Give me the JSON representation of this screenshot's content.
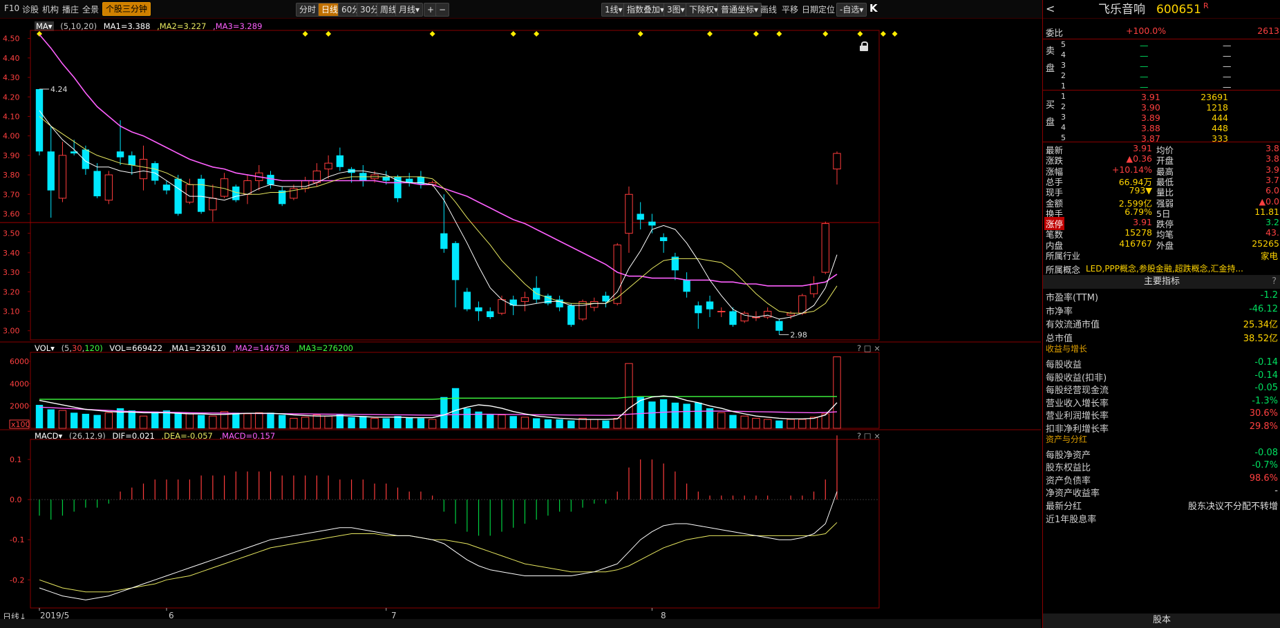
{
  "toolbar": {
    "left_items": [
      "F10",
      "诊股",
      "机构",
      "播庄",
      "全景"
    ],
    "active_item": "个股三分钟",
    "period_tabs": [
      "分时",
      "日线",
      "60分",
      "30分",
      "周线",
      "月线▾"
    ],
    "active_period": "日线",
    "zoom_in": "+",
    "zoom_out": "−",
    "right_items": [
      "1线▾",
      "指数叠加▾",
      "3图▾",
      "下除权▾",
      "普通坐标▾",
      "画线",
      "平移",
      "日期定位",
      "-自选▾"
    ],
    "expand": "K"
  },
  "ma_legend": {
    "label": "MA▾",
    "params": "(5,10,20)",
    "ma1": "MA1=3.388",
    "ma2": ",MA2=3.227",
    "ma3": ",MA3=3.289"
  },
  "vol_legend": {
    "label": "VOL▾",
    "params_a": "(5,",
    "params_b": "30",
    "params_c": ",",
    "params_d": "120)",
    "vol": "VOL=669422",
    "ma1": ",MA1=232610",
    "ma2": ",MA2=146758",
    "ma3": ",MA3=276200"
  },
  "macd_legend": {
    "label": "MACD▾",
    "params": "(26,12,9)",
    "dif": "DIF=0.021",
    "dea": ",DEA=-0.057",
    "macd": ",MACD=0.157"
  },
  "price_axis": [
    "4.50",
    "4.40",
    "4.30",
    "4.20",
    "4.10",
    "4.00",
    "3.90",
    "3.80",
    "3.70",
    "3.60",
    "3.50",
    "3.40",
    "3.30",
    "3.20",
    "3.10",
    "3.00"
  ],
  "vol_axis": [
    "6000",
    "4000",
    "2000"
  ],
  "vol_unit": "x100",
  "macd_axis": [
    "0.1",
    "0.0",
    "-0.1",
    "-0.2"
  ],
  "annotations": {
    "high": "4.24",
    "low": "2.98"
  },
  "x_labels": [
    "2019/5",
    "6",
    "7",
    "8"
  ],
  "bottom_left": "日线↓",
  "panel_controls": "? □ ×",
  "chart_data": {
    "type": "candlestick",
    "ylim": [
      2.96,
      4.52
    ],
    "candles": [
      [
        4.24,
        3.92,
        4.24,
        3.9
      ],
      [
        3.92,
        3.72,
        4.05,
        3.58
      ],
      [
        3.68,
        3.9,
        3.97,
        3.66
      ],
      [
        3.92,
        3.91,
        3.98,
        3.9
      ],
      [
        3.93,
        3.83,
        3.95,
        3.8
      ],
      [
        3.82,
        3.69,
        3.86,
        3.68
      ],
      [
        3.67,
        3.8,
        3.82,
        3.65
      ],
      [
        3.92,
        3.89,
        4.08,
        3.85
      ],
      [
        3.9,
        3.85,
        3.92,
        3.8
      ],
      [
        3.78,
        3.88,
        3.95,
        3.72
      ],
      [
        3.86,
        3.77,
        3.87,
        3.75
      ],
      [
        3.75,
        3.72,
        3.77,
        3.7
      ],
      [
        3.78,
        3.6,
        3.8,
        3.59
      ],
      [
        3.66,
        3.75,
        3.78,
        3.65
      ],
      [
        3.78,
        3.61,
        3.8,
        3.6
      ],
      [
        3.62,
        3.68,
        3.75,
        3.56
      ],
      [
        3.69,
        3.78,
        3.81,
        3.68
      ],
      [
        3.74,
        3.67,
        3.75,
        3.66
      ],
      [
        3.7,
        3.77,
        3.8,
        3.65
      ],
      [
        3.77,
        3.81,
        3.85,
        3.72
      ],
      [
        3.8,
        3.75,
        3.82,
        3.73
      ],
      [
        3.72,
        3.65,
        3.74,
        3.64
      ],
      [
        3.68,
        3.73,
        3.75,
        3.67
      ],
      [
        3.73,
        3.77,
        3.79,
        3.71
      ],
      [
        3.76,
        3.82,
        3.86,
        3.74
      ],
      [
        3.83,
        3.86,
        3.9,
        3.78
      ],
      [
        3.9,
        3.84,
        3.94,
        3.82
      ],
      [
        3.83,
        3.81,
        3.84,
        3.76
      ],
      [
        3.81,
        3.77,
        3.85,
        3.74
      ],
      [
        3.78,
        3.8,
        3.82,
        3.76
      ],
      [
        3.79,
        3.77,
        3.82,
        3.75
      ],
      [
        3.79,
        3.68,
        3.8,
        3.66
      ],
      [
        3.78,
        3.76,
        3.81,
        3.74
      ],
      [
        3.79,
        3.75,
        3.82,
        3.73
      ],
      [
        3.75,
        3.76,
        3.77,
        3.74
      ],
      [
        3.5,
        3.42,
        3.7,
        3.4
      ],
      [
        3.45,
        3.26,
        3.46,
        3.12
      ],
      [
        3.2,
        3.11,
        3.22,
        3.1
      ],
      [
        3.12,
        3.1,
        3.15,
        3.05
      ],
      [
        3.1,
        3.07,
        3.12,
        3.06
      ],
      [
        3.09,
        3.16,
        3.18,
        3.08
      ],
      [
        3.16,
        3.13,
        3.18,
        3.08
      ],
      [
        3.15,
        3.17,
        3.2,
        3.1
      ],
      [
        3.22,
        3.16,
        3.28,
        3.14
      ],
      [
        3.18,
        3.14,
        3.19,
        3.13
      ],
      [
        3.16,
        3.12,
        3.18,
        3.1
      ],
      [
        3.13,
        3.03,
        3.14,
        3.02
      ],
      [
        3.06,
        3.15,
        3.16,
        3.05
      ],
      [
        3.12,
        3.15,
        3.17,
        3.1
      ],
      [
        3.18,
        3.15,
        3.2,
        3.12
      ],
      [
        3.14,
        3.44,
        3.45,
        3.13
      ],
      [
        3.5,
        3.7,
        3.74,
        3.4
      ],
      [
        3.6,
        3.57,
        3.66,
        3.52
      ],
      [
        3.56,
        3.54,
        3.6,
        3.5
      ],
      [
        3.48,
        3.46,
        3.5,
        3.4
      ],
      [
        3.38,
        3.31,
        3.4,
        3.26
      ],
      [
        3.26,
        3.2,
        3.3,
        3.17
      ],
      [
        3.13,
        3.09,
        3.15,
        3.01
      ],
      [
        3.15,
        3.11,
        3.18,
        3.07
      ],
      [
        3.1,
        3.1,
        3.12,
        3.07
      ],
      [
        3.1,
        3.03,
        3.12,
        3.02
      ],
      [
        3.05,
        3.09,
        3.1,
        3.04
      ],
      [
        3.07,
        3.07,
        3.1,
        3.05
      ],
      [
        3.07,
        3.1,
        3.12,
        3.06
      ],
      [
        3.05,
        3.0,
        3.06,
        2.98
      ],
      [
        3.08,
        3.09,
        3.1,
        3.06
      ],
      [
        3.09,
        3.18,
        3.19,
        3.08
      ],
      [
        3.19,
        3.24,
        3.28,
        3.17
      ],
      [
        3.3,
        3.55,
        3.56,
        3.29
      ],
      [
        3.83,
        3.91,
        3.92,
        3.75
      ]
    ],
    "ma5": [
      4.13,
      4.05,
      3.98,
      3.93,
      3.87,
      3.84,
      3.84,
      3.82,
      3.81,
      3.82,
      3.81,
      3.77,
      3.73,
      3.69,
      3.69,
      3.68,
      3.67,
      3.69,
      3.7,
      3.73,
      3.75,
      3.74,
      3.74,
      3.74,
      3.76,
      3.79,
      3.81,
      3.82,
      3.82,
      3.81,
      3.8,
      3.77,
      3.76,
      3.76,
      3.75,
      3.67,
      3.56,
      3.45,
      3.33,
      3.22,
      3.16,
      3.13,
      3.13,
      3.14,
      3.15,
      3.15,
      3.13,
      3.13,
      3.14,
      3.14,
      3.2,
      3.32,
      3.41,
      3.52,
      3.54,
      3.52,
      3.45,
      3.36,
      3.26,
      3.18,
      3.11,
      3.08,
      3.07,
      3.08,
      3.06,
      3.07,
      3.09,
      3.13,
      3.22,
      3.39
    ],
    "ma10": [
      4.1,
      4.05,
      4.01,
      3.97,
      3.93,
      3.9,
      3.88,
      3.86,
      3.85,
      3.84,
      3.83,
      3.81,
      3.78,
      3.75,
      3.75,
      3.74,
      3.73,
      3.71,
      3.7,
      3.7,
      3.71,
      3.71,
      3.72,
      3.73,
      3.74,
      3.76,
      3.78,
      3.79,
      3.79,
      3.79,
      3.79,
      3.79,
      3.79,
      3.79,
      3.78,
      3.73,
      3.66,
      3.58,
      3.51,
      3.44,
      3.36,
      3.3,
      3.24,
      3.19,
      3.17,
      3.15,
      3.14,
      3.14,
      3.14,
      3.14,
      3.17,
      3.22,
      3.27,
      3.32,
      3.36,
      3.37,
      3.37,
      3.37,
      3.36,
      3.35,
      3.31,
      3.25,
      3.19,
      3.14,
      3.1,
      3.09,
      3.09,
      3.1,
      3.14,
      3.23
    ],
    "ma20": [
      4.52,
      4.45,
      4.37,
      4.3,
      4.22,
      4.15,
      4.1,
      4.05,
      4.02,
      4.0,
      3.97,
      3.94,
      3.91,
      3.88,
      3.86,
      3.84,
      3.83,
      3.81,
      3.8,
      3.79,
      3.78,
      3.77,
      3.77,
      3.77,
      3.77,
      3.77,
      3.77,
      3.77,
      3.77,
      3.77,
      3.76,
      3.76,
      3.76,
      3.75,
      3.75,
      3.73,
      3.71,
      3.69,
      3.66,
      3.63,
      3.6,
      3.57,
      3.55,
      3.52,
      3.49,
      3.46,
      3.43,
      3.4,
      3.37,
      3.34,
      3.3,
      3.28,
      3.28,
      3.27,
      3.27,
      3.27,
      3.26,
      3.26,
      3.26,
      3.25,
      3.25,
      3.24,
      3.24,
      3.23,
      3.23,
      3.23,
      3.23,
      3.24,
      3.25,
      3.29
    ],
    "volumes": [
      2100,
      1700,
      1600,
      1400,
      1300,
      1200,
      1400,
      1800,
      1600,
      1100,
      1500,
      1600,
      1400,
      1300,
      1200,
      1100,
      1500,
      1400,
      1300,
      1400,
      1400,
      1200,
      900,
      1000,
      1200,
      1100,
      1300,
      1000,
      1100,
      900,
      900,
      1100,
      1000,
      900,
      800,
      2800,
      3600,
      1800,
      1500,
      1300,
      1200,
      1100,
      1000,
      900,
      800,
      800,
      700,
      900,
      800,
      700,
      900,
      5800,
      2800,
      2400,
      2600,
      2300,
      2200,
      2300,
      1800,
      1400,
      1200,
      1100,
      900,
      800,
      700,
      800,
      800,
      1000,
      1300,
      6400
    ],
    "vol_ma1": [
      2500,
      2300,
      2100,
      1900,
      1700,
      1600,
      1500,
      1450,
      1450,
      1400,
      1400,
      1400,
      1350,
      1300,
      1300,
      1250,
      1250,
      1300,
      1350,
      1350,
      1350,
      1300,
      1200,
      1150,
      1100,
      1100,
      1150,
      1100,
      1050,
      1000,
      1000,
      1000,
      950,
      950,
      950,
      1200,
      1600,
      1900,
      2100,
      2000,
      1800,
      1500,
      1300,
      1100,
      1000,
      900,
      850,
      800,
      800,
      800,
      850,
      1800,
      2500,
      2800,
      2900,
      2800,
      2500,
      2300,
      2000,
      1800,
      1500,
      1300,
      1100,
      1000,
      900,
      850,
      850,
      900,
      1200,
      2300
    ],
    "vol_ma2": [
      1900,
      1850,
      1800,
      1750,
      1700,
      1650,
      1600,
      1550,
      1500,
      1480,
      1460,
      1440,
      1420,
      1400,
      1380,
      1370,
      1360,
      1350,
      1340,
      1330,
      1320,
      1310,
      1300,
      1290,
      1280,
      1270,
      1260,
      1250,
      1240,
      1230,
      1220,
      1210,
      1200,
      1190,
      1180,
      1200,
      1230,
      1250,
      1260,
      1260,
      1250,
      1240,
      1230,
      1220,
      1210,
      1200,
      1190,
      1180,
      1170,
      1160,
      1170,
      1260,
      1320,
      1380,
      1440,
      1480,
      1510,
      1530,
      1540,
      1540,
      1530,
      1510,
      1490,
      1470,
      1450,
      1430,
      1410,
      1400,
      1420,
      1480
    ],
    "vol_ma3": [
      2600,
      2600,
      2600,
      2600,
      2600,
      2600,
      2600,
      2600,
      2600,
      2600,
      2600,
      2600,
      2600,
      2600,
      2600,
      2600,
      2600,
      2600,
      2600,
      2600,
      2600,
      2600,
      2600,
      2600,
      2600,
      2600,
      2600,
      2600,
      2600,
      2600,
      2600,
      2600,
      2600,
      2600,
      2600,
      2650,
      2700,
      2700,
      2700,
      2700,
      2700,
      2700,
      2700,
      2700,
      2700,
      2700,
      2700,
      2700,
      2700,
      2700,
      2700,
      2800,
      2850,
      2850,
      2850,
      2850,
      2850,
      2850,
      2850,
      2850,
      2850,
      2850,
      2850,
      2850,
      2850,
      2850,
      2850,
      2850,
      2850,
      2850
    ],
    "macd_hist": [
      -0.04,
      -0.05,
      -0.04,
      -0.03,
      -0.02,
      -0.02,
      -0.01,
      0.02,
      0.03,
      0.04,
      0.05,
      0.05,
      0.05,
      0.05,
      0.06,
      0.06,
      0.06,
      0.07,
      0.07,
      0.07,
      0.07,
      0.06,
      0.06,
      0.06,
      0.06,
      0.06,
      0.05,
      0.05,
      0.05,
      0.04,
      0.04,
      0.03,
      0.02,
      0.02,
      0.01,
      -0.03,
      -0.06,
      -0.08,
      -0.09,
      -0.09,
      -0.08,
      -0.07,
      -0.06,
      -0.05,
      -0.04,
      -0.03,
      -0.03,
      -0.02,
      -0.01,
      -0.01,
      0.02,
      0.08,
      0.1,
      0.1,
      0.09,
      0.07,
      0.04,
      0.02,
      0.01,
      0.01,
      0.01,
      0.01,
      0.01,
      0.01,
      0.0,
      0.01,
      0.01,
      0.02,
      0.05,
      0.16
    ],
    "macd_dif": [
      -0.22,
      -0.23,
      -0.24,
      -0.245,
      -0.25,
      -0.245,
      -0.24,
      -0.23,
      -0.22,
      -0.21,
      -0.2,
      -0.19,
      -0.18,
      -0.17,
      -0.16,
      -0.15,
      -0.14,
      -0.13,
      -0.12,
      -0.11,
      -0.1,
      -0.095,
      -0.09,
      -0.085,
      -0.08,
      -0.075,
      -0.07,
      -0.07,
      -0.075,
      -0.08,
      -0.085,
      -0.09,
      -0.09,
      -0.095,
      -0.1,
      -0.11,
      -0.13,
      -0.15,
      -0.165,
      -0.175,
      -0.18,
      -0.185,
      -0.19,
      -0.19,
      -0.19,
      -0.19,
      -0.19,
      -0.185,
      -0.18,
      -0.17,
      -0.16,
      -0.13,
      -0.1,
      -0.08,
      -0.065,
      -0.06,
      -0.06,
      -0.065,
      -0.07,
      -0.075,
      -0.08,
      -0.085,
      -0.09,
      -0.095,
      -0.1,
      -0.1,
      -0.095,
      -0.085,
      -0.06,
      0.02
    ],
    "macd_dea": [
      -0.2,
      -0.21,
      -0.22,
      -0.225,
      -0.23,
      -0.23,
      -0.23,
      -0.225,
      -0.22,
      -0.215,
      -0.21,
      -0.2,
      -0.195,
      -0.19,
      -0.18,
      -0.17,
      -0.16,
      -0.15,
      -0.14,
      -0.13,
      -0.12,
      -0.115,
      -0.11,
      -0.105,
      -0.1,
      -0.095,
      -0.09,
      -0.085,
      -0.085,
      -0.085,
      -0.09,
      -0.09,
      -0.09,
      -0.095,
      -0.1,
      -0.1,
      -0.105,
      -0.11,
      -0.12,
      -0.13,
      -0.14,
      -0.15,
      -0.16,
      -0.165,
      -0.17,
      -0.175,
      -0.18,
      -0.18,
      -0.18,
      -0.18,
      -0.175,
      -0.165,
      -0.15,
      -0.135,
      -0.12,
      -0.11,
      -0.1,
      -0.095,
      -0.09,
      -0.09,
      -0.09,
      -0.09,
      -0.09,
      -0.09,
      -0.09,
      -0.09,
      -0.09,
      -0.09,
      -0.085,
      -0.057
    ],
    "event_markers": [
      0,
      23,
      25,
      34,
      41,
      43,
      52,
      58,
      62,
      64,
      68,
      71,
      73,
      74
    ],
    "h_line_price": 3.555
  },
  "right_panel": {
    "stock_name": "飞乐音响",
    "stock_code": "600651",
    "badge": "R",
    "wei_bi_label": "委比",
    "wei_bi_value": "+100.0%",
    "wei_cha": "2613",
    "sell_label": "卖盘",
    "buy_label": "买盘",
    "sell_rows": [
      {
        "n": "5",
        "p": "—",
        "v": "—"
      },
      {
        "n": "4",
        "p": "—",
        "v": "—"
      },
      {
        "n": "3",
        "p": "—",
        "v": "—"
      },
      {
        "n": "2",
        "p": "—",
        "v": "—"
      },
      {
        "n": "1",
        "p": "—",
        "v": "—"
      }
    ],
    "buy_rows": [
      {
        "n": "1",
        "p": "3.91",
        "v": "23691"
      },
      {
        "n": "2",
        "p": "3.90",
        "v": "1218"
      },
      {
        "n": "3",
        "p": "3.89",
        "v": "444"
      },
      {
        "n": "4",
        "p": "3.88",
        "v": "448"
      },
      {
        "n": "5",
        "p": "3.87",
        "v": "333"
      }
    ],
    "quote_rows": [
      {
        "l1": "最新",
        "v1": "3.91",
        "l2": "均价",
        "v2": "3.8"
      },
      {
        "l1": "涨跌",
        "v1": "▲0.36",
        "l2": "开盘",
        "v2": "3.8"
      },
      {
        "l1": "涨幅",
        "v1": "+10.14%",
        "l2": "最高",
        "v2": "3.9"
      },
      {
        "l1": "总手",
        "v1": "66.94万",
        "l2": "最低",
        "v2": "3.7"
      },
      {
        "l1": "现手",
        "v1": "793▼",
        "l2": "量比",
        "v2": "6.0"
      },
      {
        "l1": "金额",
        "v1": "2.599亿",
        "l2": "强弱",
        "v2": "▲0.0"
      },
      {
        "l1": "换手",
        "v1": "6.79%",
        "l2": "5日",
        "v2": "11.81"
      },
      {
        "l1": "涨停",
        "v1": "3.91",
        "l2": "跌停",
        "v2": "3.2"
      },
      {
        "l1": "笔数",
        "v1": "15278",
        "l2": "均笔",
        "v2": "43."
      },
      {
        "l1": "内盘",
        "v1": "416767",
        "l2": "外盘",
        "v2": "25265"
      }
    ],
    "industry_label": "所属行业",
    "industry_value": "家电",
    "concept_label": "所属概念",
    "concept_value": "LED,PPP概念,参股金融,超跌概念,汇金持...",
    "main_index_title": "主要指标",
    "help_mark": "?",
    "main_indices": [
      {
        "l": "市盈率(TTM)",
        "v": "-1.2"
      },
      {
        "l": "市净率",
        "v": "-46.12"
      },
      {
        "l": "有效流通市值",
        "v": "25.34亿"
      },
      {
        "l": "总市值",
        "v": "38.52亿"
      }
    ],
    "income_title": "收益与增长",
    "income_rows": [
      {
        "l": "每股收益",
        "v": "-0.14"
      },
      {
        "l": "每股收益(扣非)",
        "v": "-0.14"
      },
      {
        "l": "每股经营现金流",
        "v": "-0.05"
      },
      {
        "l": "营业收入增长率",
        "v": "-1.3%"
      },
      {
        "l": "营业利润增长率",
        "v": "30.6%"
      },
      {
        "l": "扣非净利增长率",
        "v": "29.8%"
      }
    ],
    "asset_title": "资产与分红",
    "asset_rows": [
      {
        "l": "每股净资产",
        "v": "-0.08"
      },
      {
        "l": "股东权益比",
        "v": "-0.7%"
      },
      {
        "l": "资产负债率",
        "v": "98.6%"
      },
      {
        "l": "净资产收益率",
        "v": "-"
      },
      {
        "l": "最新分红",
        "v": "股东决议不分配不转增"
      },
      {
        "l": "近1年股息率",
        "v": ""
      }
    ],
    "bottom_title": "股本"
  },
  "colors": {
    "up": "#ff3c3c",
    "down": "#00e8ff",
    "ma1": "#ffffff",
    "ma2": "#e8e860",
    "ma3": "#ff60ff",
    "vol_ma3": "#40ff40",
    "grid": "#8a0000",
    "marker": "#ffee00"
  }
}
